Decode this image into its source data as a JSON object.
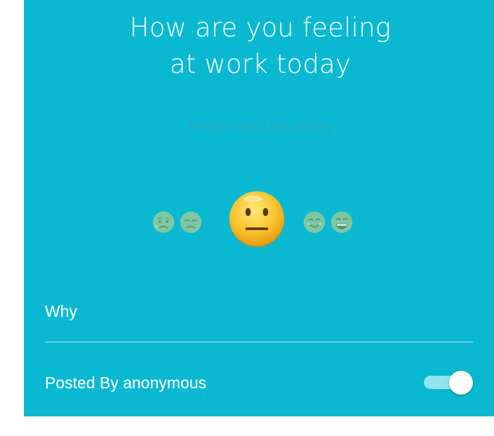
{
  "header": {
    "title_line1": "How are you feeling",
    "title_line2": "at work today",
    "subtitle": "Please select any smiley"
  },
  "smileys": {
    "items": [
      {
        "icon": "tearful-face-icon",
        "selected": false
      },
      {
        "icon": "sad-face-icon",
        "selected": false
      },
      {
        "icon": "neutral-face-icon",
        "selected": true
      },
      {
        "icon": "smiling-face-icon",
        "selected": false
      },
      {
        "icon": "grinning-face-icon",
        "selected": false
      }
    ]
  },
  "why": {
    "label": "Why"
  },
  "anonymous": {
    "label": "Posted By anonymous",
    "toggle_on": true
  },
  "colors": {
    "background": "#0ab8d2",
    "subtitle": "#2fa5b5",
    "toggle_track": "#8fe4ef",
    "selected_smiley": "#f6b21c",
    "inactive_smiley": "#7ec7a2"
  }
}
